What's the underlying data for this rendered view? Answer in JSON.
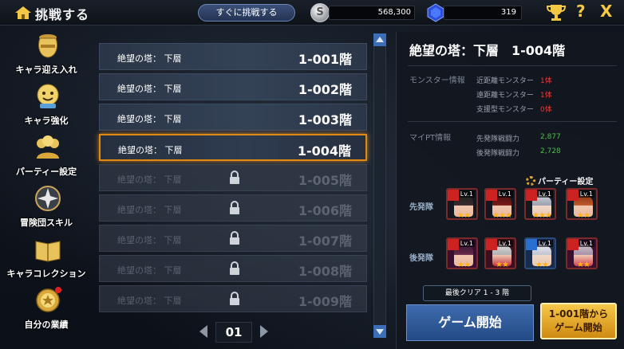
{
  "header": {
    "title": "挑戦する",
    "quick_challenge": "すぐに挑戦する",
    "silver_symbol": "S",
    "silver": "568,300",
    "gems": "319",
    "help": "?",
    "close": "X"
  },
  "sidebar": {
    "items": [
      {
        "label": "キャラ迎え入れ",
        "icon": "vase-icon"
      },
      {
        "label": "キャラ強化",
        "icon": "levelup-icon"
      },
      {
        "label": "パーティー設定",
        "icon": "party-icon"
      },
      {
        "label": "冒険団スキル",
        "icon": "skill-icon"
      },
      {
        "label": "キャラコレクション",
        "icon": "collection-icon"
      },
      {
        "label": "自分の業績",
        "icon": "medal-icon"
      }
    ]
  },
  "stages": {
    "rows": [
      {
        "name": "絶望の塔： 下層",
        "floor": "1-001階",
        "state": "open"
      },
      {
        "name": "絶望の塔： 下層",
        "floor": "1-002階",
        "state": "open"
      },
      {
        "name": "絶望の塔： 下層",
        "floor": "1-003階",
        "state": "open"
      },
      {
        "name": "絶望の塔： 下層",
        "floor": "1-004階",
        "state": "selected"
      },
      {
        "name": "絶望の塔： 下層",
        "floor": "1-005階",
        "state": "locked"
      },
      {
        "name": "絶望の塔： 下層",
        "floor": "1-006階",
        "state": "locked"
      },
      {
        "name": "絶望の塔： 下層",
        "floor": "1-007階",
        "state": "locked"
      },
      {
        "name": "絶望の塔： 下層",
        "floor": "1-008階",
        "state": "locked"
      },
      {
        "name": "絶望の塔： 下層",
        "floor": "1-009階",
        "state": "locked"
      }
    ],
    "page": "01"
  },
  "detail": {
    "title": "絶望の塔：下層　1-004階",
    "monster_info": "モンスター情報",
    "monsters": [
      {
        "label": "近距離モンスター",
        "value": "1体"
      },
      {
        "label": "遠距離モンスター",
        "value": "1体"
      },
      {
        "label": "支援型モンスター",
        "value": "0体"
      }
    ],
    "pt_info": "マイPT情報",
    "power": [
      {
        "label": "先発隊戦闘力",
        "value": "2,877"
      },
      {
        "label": "後発隊戦闘力",
        "value": "2,728"
      }
    ],
    "party_setting": "パーティー設定",
    "front_team": "先発隊",
    "back_team": "後発隊",
    "level_tag": "Lv.1",
    "front_stars": [
      "★★",
      "★★★",
      "★★★",
      "★★"
    ],
    "back_stars": [
      "★★",
      "★★",
      "★★",
      "★★"
    ],
    "last_clear": "最後クリア 1 - 3 階",
    "start": "ゲーム開始",
    "start_from_line1": "1-001階から",
    "start_from_line2": "ゲーム開始"
  },
  "colors": {
    "accent": "#e08a14",
    "blue_button": "#2d5a9a",
    "gold_button": "#e8a82a",
    "red_value": "#e33b3b",
    "green_value": "#4bc04b"
  }
}
